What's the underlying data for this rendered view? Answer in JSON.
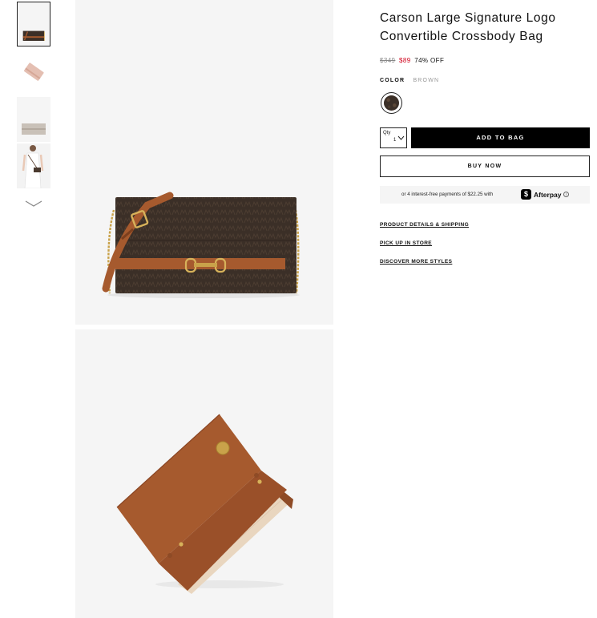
{
  "product": {
    "title_line1": "Carson Large Signature Logo",
    "title_line2": "Convertible Crossbody Bag",
    "price_original": "$349",
    "price_sale": "$89",
    "discount": "74% OFF",
    "color_label": "COLOR",
    "color_value": "BROWN"
  },
  "purchase": {
    "qty_label": "Qty",
    "qty_value": "1",
    "add_to_bag": "ADD TO BAG",
    "buy_now": "BUY NOW"
  },
  "afterpay": {
    "text": "or 4 interest-free payments of $22.25 with",
    "logo_glyph": "$",
    "brand": "Afterpay",
    "info_glyph": "i"
  },
  "links": {
    "details": "PRODUCT DETAILS & SHIPPING",
    "pickup": "PICK UP IN STORE",
    "discover": "DISCOVER MORE STYLES"
  },
  "colors": {
    "sale_red": "#d0021b",
    "button_black": "#000000",
    "bag_brown": "#3b2f27",
    "leather_tan": "#a65a2e"
  }
}
